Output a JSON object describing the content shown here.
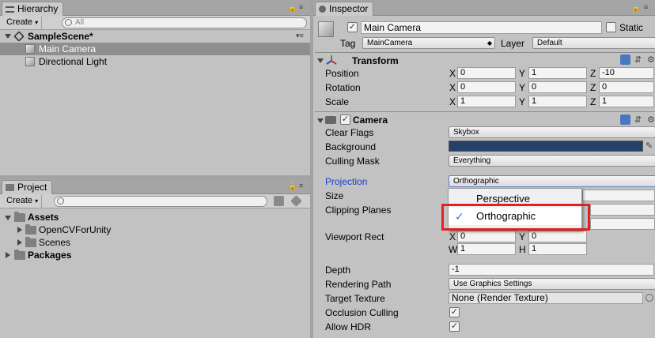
{
  "hierarchy": {
    "tab_label": "Hierarchy",
    "create_label": "Create",
    "search_placeholder": "All",
    "scene_name": "SampleScene*",
    "items": [
      {
        "label": "Main Camera",
        "selected": true
      },
      {
        "label": "Directional Light",
        "selected": false
      }
    ]
  },
  "project": {
    "tab_label": "Project",
    "create_label": "Create",
    "tree": [
      {
        "label": "Assets",
        "bold": true
      },
      {
        "label": "OpenCVForUnity",
        "bold": false
      },
      {
        "label": "Scenes",
        "bold": false
      },
      {
        "label": "Packages",
        "bold": true
      }
    ]
  },
  "inspector": {
    "tab_label": "Inspector",
    "object_name": "Main Camera",
    "static_label": "Static",
    "tag_label": "Tag",
    "tag_value": "MainCamera",
    "layer_label": "Layer",
    "layer_value": "Default",
    "transform": {
      "title": "Transform",
      "rows": [
        {
          "label": "Position",
          "x": "0",
          "y": "1",
          "z": "-10"
        },
        {
          "label": "Rotation",
          "x": "0",
          "y": "0",
          "z": "0"
        },
        {
          "label": "Scale",
          "x": "1",
          "y": "1",
          "z": "1"
        }
      ],
      "axis_x": "X",
      "axis_y": "Y",
      "axis_z": "Z"
    },
    "camera": {
      "title": "Camera",
      "clear_flags_label": "Clear Flags",
      "clear_flags_value": "Skybox",
      "background_label": "Background",
      "background_color": "#25406b",
      "culling_mask_label": "Culling Mask",
      "culling_mask_value": "Everything",
      "projection_label": "Projection",
      "projection_value": "Orthographic",
      "size_label": "Size",
      "clipping_planes_label": "Clipping Planes",
      "viewport_rect_label": "Viewport Rect",
      "viewport": {
        "x": "0",
        "y": "0",
        "w": "1",
        "h": "1",
        "axis_x": "X",
        "axis_y": "Y",
        "axis_w": "W",
        "axis_h": "H"
      },
      "depth_label": "Depth",
      "depth_value": "-1",
      "rendering_path_label": "Rendering Path",
      "rendering_path_value": "Use Graphics Settings",
      "target_texture_label": "Target Texture",
      "target_texture_value": "None (Render Texture)",
      "occlusion_culling_label": "Occlusion Culling",
      "allow_hdr_label": "Allow HDR"
    },
    "projection_menu": {
      "options": [
        {
          "label": "Perspective",
          "checked": false
        },
        {
          "label": "Orthographic",
          "checked": true
        }
      ],
      "checkmark": "✓"
    }
  },
  "colors": {
    "selection": "#8f8f8f",
    "highlight_box": "#e32020",
    "projection_label": "#1a3fc7",
    "check_blue": "#3a6fd0"
  }
}
